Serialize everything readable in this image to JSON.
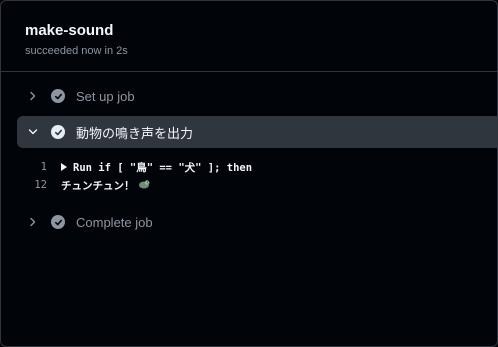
{
  "job": {
    "title": "make-sound",
    "status": "succeeded now in 2s"
  },
  "steps": [
    {
      "label": "Set up job",
      "expanded": false
    },
    {
      "label": "動物の鳴き声を出力",
      "expanded": true
    },
    {
      "label": "Complete job",
      "expanded": false
    }
  ],
  "log": [
    {
      "line": "1",
      "text": "Run if [ \"鳥\" == \"犬\" ]; then"
    },
    {
      "line": "12",
      "text": "チュンチュン！"
    }
  ],
  "icons": {
    "collapsed": "chevron-right-icon",
    "expanded": "chevron-down-icon",
    "status": "check-circle-icon",
    "emoji": "bird-icon"
  },
  "colors": {
    "background": "#010409",
    "expanded_row": "#30363d",
    "muted_text": "#8d96a0",
    "text": "#f0f6fc"
  }
}
